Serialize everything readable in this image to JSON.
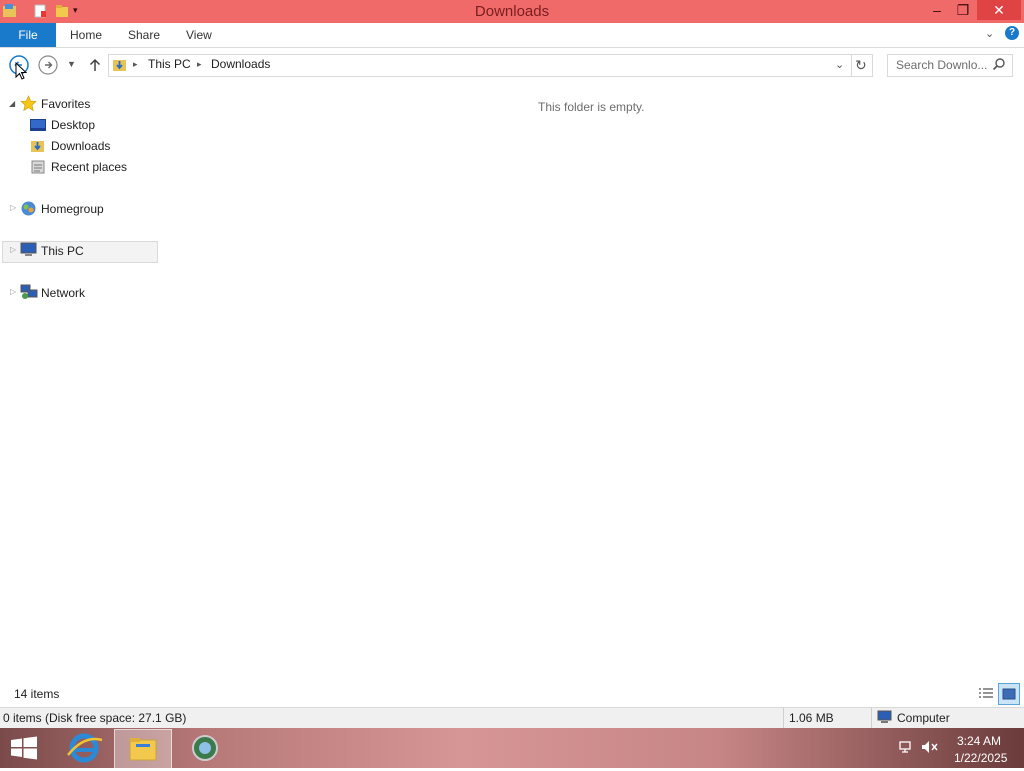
{
  "window": {
    "title": "Downloads"
  },
  "ribbon": {
    "tabs": [
      "File",
      "Home",
      "Share",
      "View"
    ]
  },
  "address": {
    "crumb_root": "This PC",
    "crumb_current": "Downloads"
  },
  "search": {
    "placeholder": "Search Downlo..."
  },
  "nav": {
    "favorites": "Favorites",
    "favorites_items": [
      "Desktop",
      "Downloads",
      "Recent places"
    ],
    "homegroup": "Homegroup",
    "thispc": "This PC",
    "network": "Network"
  },
  "content": {
    "empty_message": "This folder is empty."
  },
  "status": {
    "items_count": "14 items",
    "disk_info": "0 items (Disk free space: 27.1 GB)",
    "size": "1.06 MB",
    "location": "Computer"
  },
  "clock": {
    "time": "3:24 AM",
    "date": "1/22/2025"
  },
  "colors": {
    "titlebar": "#f06a6a",
    "file_tab": "#1979ca",
    "close": "#e04343"
  }
}
